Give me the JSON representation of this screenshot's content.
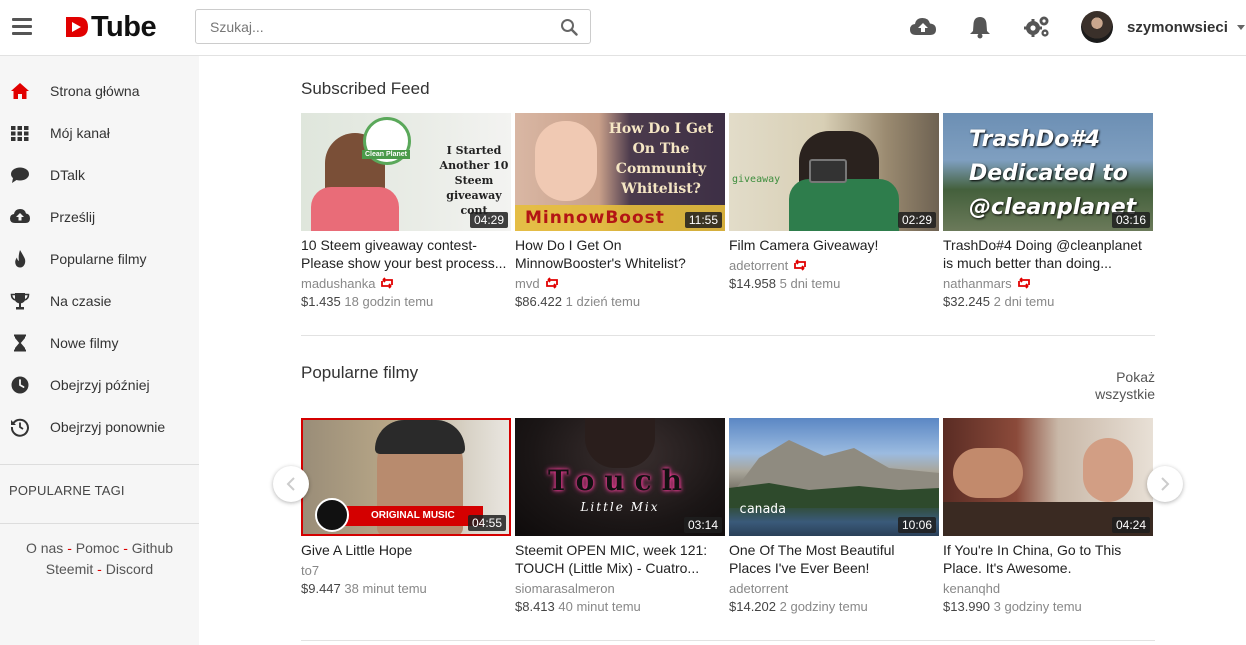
{
  "header": {
    "logo_text": "Tube",
    "search_placeholder": "Szukaj...",
    "username": "szymonwsieci",
    "icons": [
      "menu-icon",
      "upload-cloud-icon",
      "bell-icon",
      "settings-icon",
      "search-icon"
    ]
  },
  "sidebar": {
    "items": [
      {
        "label": "Strona główna",
        "icon": "home-icon",
        "active": true
      },
      {
        "label": "Mój kanał",
        "icon": "grid-icon"
      },
      {
        "label": "DTalk",
        "icon": "comment-icon"
      },
      {
        "label": "Prześlij",
        "icon": "upload-icon"
      },
      {
        "label": "Popularne filmy",
        "icon": "fire-icon"
      },
      {
        "label": "Na czasie",
        "icon": "trophy-icon"
      },
      {
        "label": "Nowe filmy",
        "icon": "hourglass-icon"
      },
      {
        "label": "Obejrzyj później",
        "icon": "clock-icon"
      },
      {
        "label": "Obejrzyj ponownie",
        "icon": "history-icon"
      }
    ],
    "tags_title": "POPULARNE TAGI",
    "footer": {
      "o_nas": "O nas",
      "pomoc": "Pomoc",
      "github": "Github",
      "steemit": "Steemit",
      "discord": "Discord",
      "sep": "-"
    }
  },
  "subscribed": {
    "title": "Subscribed Feed",
    "videos": [
      {
        "title": "10 Steem giveaway contest-Please show your best process...",
        "author": "madushanka",
        "resteem": true,
        "price": "$1.435",
        "time": "18 godzin temu",
        "duration": "04:29",
        "thumb_text": "I Started Another 10 Steem giveaway cont",
        "badge_text": "Clean Planet"
      },
      {
        "title": "How Do I Get On MinnowBooster's Whitelist?",
        "author": "mvd",
        "resteem": true,
        "price": "$86.422",
        "time": "1 dzień temu",
        "duration": "11:55",
        "thumb_text": "How Do I Get On The Community Whitelist?",
        "badge_text": "MinnowBoost"
      },
      {
        "title": "Film Camera Giveaway!",
        "author": "adetorrent",
        "resteem": true,
        "price": "$14.958",
        "time": "5 dni temu",
        "duration": "02:29",
        "thumb_text": "giveaway"
      },
      {
        "title": "TrashDo#4 Doing @cleanplanet is much better than doing...",
        "author": "nathanmars",
        "resteem": true,
        "price": "$32.245",
        "time": "2 dni temu",
        "duration": "03:16",
        "thumb_text": "TrashDo#4 Dedicated to @cleanplanet"
      }
    ]
  },
  "popular": {
    "title": "Popularne filmy",
    "show_all": "Pokaż wszystkie",
    "videos": [
      {
        "title": "Give A Little Hope",
        "author": "to7",
        "price": "$9.447",
        "time": "38 minut temu",
        "duration": "04:55",
        "thumb_text": "ORIGINAL MUSIC"
      },
      {
        "title": "Steemit OPEN MIC, week 121: TOUCH (Little Mix) - Cuatro...",
        "author": "siomarasalmeron",
        "price": "$8.413",
        "time": "40 minut temu",
        "duration": "03:14",
        "thumb_text": "Touch",
        "thumb_sub": "Little Mix"
      },
      {
        "title": "One Of The Most Beautiful Places I've Ever Been!",
        "author": "adetorrent",
        "price": "$14.202",
        "time": "2 godziny temu",
        "duration": "10:06",
        "thumb_text": "canada"
      },
      {
        "title": "If You're In China, Go to This Place. It's Awesome.",
        "author": "kenanqhd",
        "price": "$13.990",
        "time": "3 godziny temu",
        "duration": "04:24"
      }
    ]
  },
  "colors": {
    "brand_red": "#e10000",
    "sidebar_bg": "#f6f6f6"
  }
}
